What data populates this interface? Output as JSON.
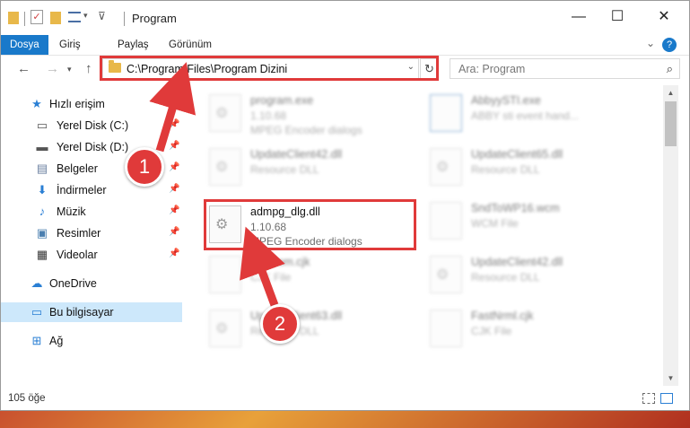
{
  "window": {
    "title": "Program",
    "controls": {
      "minimize": "—",
      "maximize": "☐",
      "close": "✕"
    }
  },
  "ribbon": {
    "tabs": [
      "Dosya",
      "Giriş",
      "Paylaş",
      "Görünüm"
    ],
    "help": "?"
  },
  "address": {
    "path": "C:\\Program Files\\Program Dizini",
    "search_placeholder": "Ara: Program"
  },
  "sidebar": {
    "items": [
      {
        "label": "Hızlı erişim",
        "icon": "star-icon"
      },
      {
        "label": "Yerel Disk (C:)",
        "icon": "drive-icon"
      },
      {
        "label": "Yerel Disk (D:)",
        "icon": "drive-icon"
      },
      {
        "label": "Belgeler",
        "icon": "documents-icon"
      },
      {
        "label": "İndirmeler",
        "icon": "download-icon"
      },
      {
        "label": "Müzik",
        "icon": "music-icon"
      },
      {
        "label": "Resimler",
        "icon": "pictures-icon"
      },
      {
        "label": "Videolar",
        "icon": "video-icon"
      },
      {
        "label": "OneDrive",
        "icon": "cloud-icon"
      },
      {
        "label": "Bu bilgisayar",
        "icon": "computer-icon"
      },
      {
        "label": "Ağ",
        "icon": "network-icon"
      }
    ]
  },
  "files": [
    {
      "name": "program.exe",
      "line2": "1.10.68",
      "line3": "MPEG Encoder dialogs"
    },
    {
      "name": "AbbyySTI.exe",
      "line2": "ABBY sti event hand...",
      "line3": ""
    },
    {
      "name": "UpdateClient42.dll",
      "line2": "Resource DLL",
      "line3": ""
    },
    {
      "name": "UpdateClient65.dll",
      "line2": "Resource DLL",
      "line3": ""
    },
    {
      "name": "admpg_dlg.dll",
      "line2": "1.10.68",
      "line3": "MPEG Encoder dialogs"
    },
    {
      "name": "SndToWP16.wcm",
      "line2": "WCM File",
      "line3": ""
    },
    {
      "name": "Visacom.cjk",
      "line2": "CJK File",
      "line3": ""
    },
    {
      "name": "UpdateClient42.dll",
      "line2": "Resource DLL",
      "line3": ""
    },
    {
      "name": "UpdateClient63.dll",
      "line2": "Resource DLL",
      "line3": ""
    },
    {
      "name": "FastNrml.cjk",
      "line2": "CJK File",
      "line3": ""
    }
  ],
  "status": {
    "count": "105 öğe"
  },
  "annotations": {
    "badge1": "1",
    "badge2": "2"
  },
  "colors": {
    "accent": "#1979ca",
    "highlight": "#e03a3a",
    "selected": "#cde8fb"
  }
}
